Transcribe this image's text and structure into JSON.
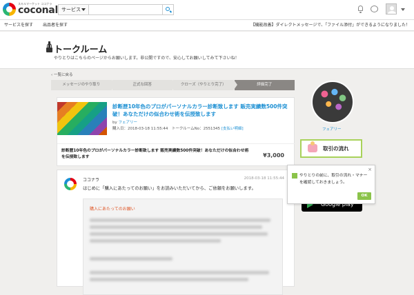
{
  "header": {
    "logo_tagline": "スキルマーケット ココナラ",
    "logo_name": "coconala",
    "search_category": "サービス",
    "search_placeholder": ""
  },
  "nav": {
    "find_service": "サービスを探す",
    "find_seller": "出品者を探す",
    "announcement": "【機能改善】ダイレクトメッセージで、「ファイル添付」ができるようになりました！"
  },
  "page": {
    "title": "トークルーム",
    "subtitle": "やりとりはこちらのページからお願いします。非公開ですので、安心してお願いしてみて下さいね！"
  },
  "back_link": "一覧に戻る",
  "steps": [
    {
      "label": "メッセージのやり取り",
      "done": false
    },
    {
      "label": "正式な回答",
      "done": false
    },
    {
      "label": "クローズ（やりとり完了）",
      "done": false
    },
    {
      "label": "評価完了",
      "done": true
    }
  ],
  "service": {
    "title": "診断歴10年色のプロがパーソナルカラー診断致します 販売実績数500件突破！あなただけの似合わせ術を伝授致します",
    "by_label": "by",
    "seller": "フェアリー",
    "purchase_info": "購入日：2018-03-18 11:55:44　トークルームNo：2551345",
    "payment_link": "[支払い明細]",
    "product_text": "診断歴10年色のプロがパーソナルカラー診断致します 販売実績数500件突破！あなただけの似合わせ術を伝授致します",
    "price": "¥3,000"
  },
  "message": {
    "sender": "ココナラ",
    "time": "2018-03-18 11:55:44",
    "body": "はじめに「購入にあたってのお願い」をお読みいただいてから、ご依頼をお願いします。",
    "notice_title": "購入にあたってのお願い"
  },
  "sidebar": {
    "seller_name": "フェアリー",
    "flow_button": "取引の流れ"
  },
  "tooltip": {
    "text": "やりとりの前に、取引の流れ・マナーを確認しておきましょう。",
    "close": "×",
    "ok": "OK"
  },
  "store_badge": "Google play"
}
